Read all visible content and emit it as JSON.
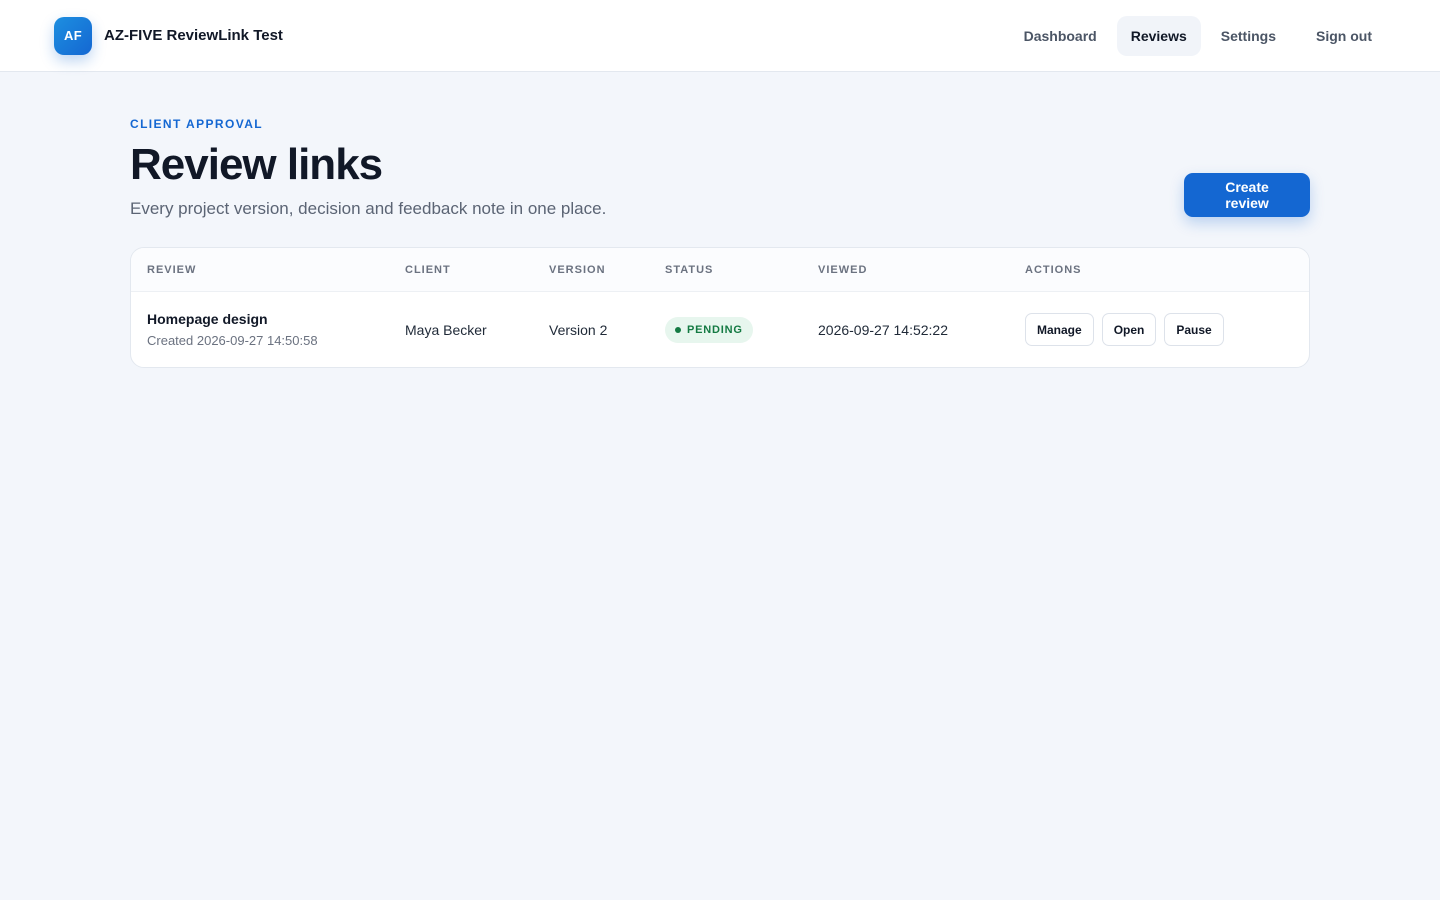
{
  "brand": {
    "logo_initials": "AF",
    "app_name": "AZ-FIVE ReviewLink Test",
    "accent": "#1467d2"
  },
  "nav": {
    "items": [
      {
        "label": "Dashboard",
        "active": false
      },
      {
        "label": "Reviews",
        "active": true
      },
      {
        "label": "Settings",
        "active": false
      },
      {
        "label": "Sign out",
        "active": false
      }
    ]
  },
  "page": {
    "eyebrow": "CLIENT APPROVAL",
    "title": "Review links",
    "subtitle": "Every project version, decision and feedback note in one place.",
    "create_button": "Create review"
  },
  "table": {
    "columns": [
      "REVIEW",
      "CLIENT",
      "VERSION",
      "STATUS",
      "VIEWED",
      "ACTIONS"
    ],
    "rows": [
      {
        "review": "Homepage design",
        "created": "Created 2026-09-27 14:50:58",
        "client": "Maya Becker",
        "version": "Version 2",
        "status": "PENDING",
        "status_color": "#147a43",
        "viewed": "2026-09-27 14:52:22",
        "actions": [
          "Manage",
          "Open",
          "Pause"
        ]
      }
    ]
  }
}
